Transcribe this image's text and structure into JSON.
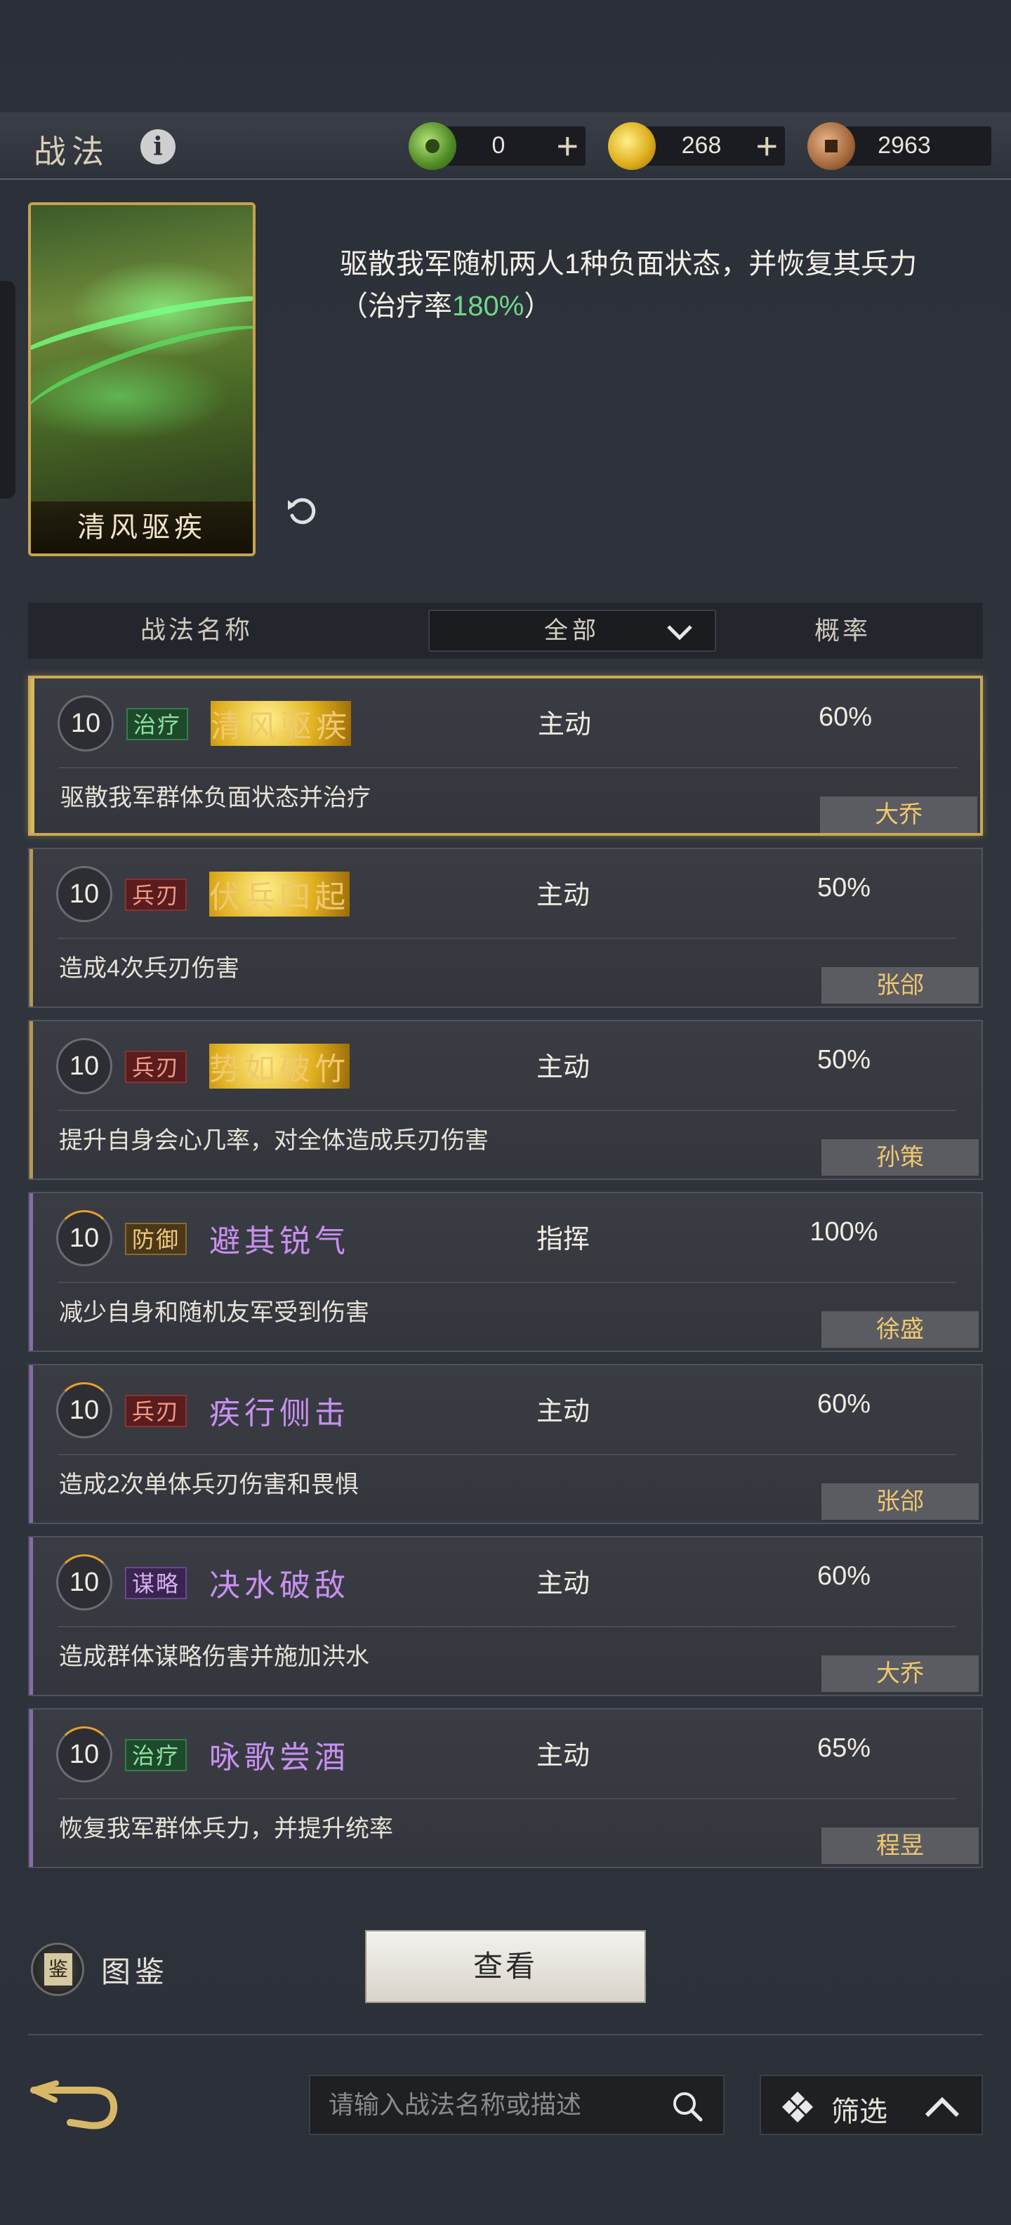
{
  "header": {
    "title": "战法",
    "info_icon": "i",
    "currencies": [
      {
        "name": "jade",
        "value": "0",
        "icon": "jade-coin-icon"
      },
      {
        "name": "gold",
        "value": "268",
        "icon": "gold-coin-icon"
      },
      {
        "name": "copper",
        "value": "2963",
        "icon": "copper-coin-icon"
      }
    ]
  },
  "hero": {
    "card_name": "清风驱疾",
    "desc_prefix": "驱散我军随机两人1种负面状态，并恢复其兵力（治疗率",
    "desc_highlight": "180%",
    "desc_suffix": "）",
    "highlight_color": "#6fd78a"
  },
  "table": {
    "col_name": "战法名称",
    "filter_value": "全部",
    "col_rate": "概率"
  },
  "rows": [
    {
      "level": "10",
      "tag": "治疗",
      "name": "清风驱疾",
      "type": "主动",
      "rate": "60%",
      "desc": "驱散我军群体负面状态并治疗",
      "owner": "大乔"
    },
    {
      "level": "10",
      "tag": "兵刃",
      "name": "伏兵四起",
      "type": "主动",
      "rate": "50%",
      "desc": "造成4次兵刃伤害",
      "owner": "张郃"
    },
    {
      "level": "10",
      "tag": "兵刃",
      "name": "势如破竹",
      "type": "主动",
      "rate": "50%",
      "desc": "提升自身会心几率，对全体造成兵刃伤害",
      "owner": "孙策"
    },
    {
      "level": "10",
      "tag": "防御",
      "name": "避其锐气",
      "type": "指挥",
      "rate": "100%",
      "desc": "减少自身和随机友军受到伤害",
      "owner": "徐盛"
    },
    {
      "level": "10",
      "tag": "兵刃",
      "name": "疾行侧击",
      "type": "主动",
      "rate": "60%",
      "desc": "造成2次单体兵刃伤害和畏惧",
      "owner": "张郃"
    },
    {
      "level": "10",
      "tag": "谋略",
      "name": "决水破敌",
      "type": "主动",
      "rate": "60%",
      "desc": "造成群体谋略伤害并施加洪水",
      "owner": "大乔"
    },
    {
      "level": "10",
      "tag": "治疗",
      "name": "咏歌尝酒",
      "type": "主动",
      "rate": "65%",
      "desc": "恢复我军群体兵力，并提升统率",
      "owner": "程昱"
    }
  ],
  "bottom": {
    "atlas_label": "图鉴",
    "atlas_icon_char": "鉴",
    "view_button": "查看",
    "search_placeholder": "请输入战法名称或描述",
    "search_value": "",
    "filter_label": "筛选"
  },
  "colors": {
    "gold_border": "#c6a24e",
    "gold_text": "#f0c870",
    "purple_text": "#c890f0"
  }
}
